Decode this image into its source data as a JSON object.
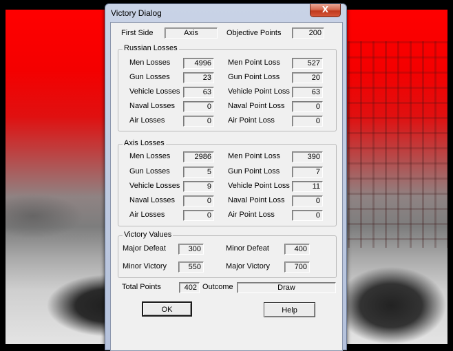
{
  "window": {
    "title": "Victory Dialog",
    "close_glyph": "X"
  },
  "first_side": {
    "label": "First Side",
    "value": "Axis"
  },
  "objective_points": {
    "label": "Objective Points",
    "value": "200"
  },
  "russian_losses": {
    "title": "Russian Losses",
    "rows": [
      {
        "left_label": "Men Losses",
        "left_value": "4996",
        "right_label": "Men Point Loss",
        "right_value": "527"
      },
      {
        "left_label": "Gun Losses",
        "left_value": "23",
        "right_label": "Gun Point Loss",
        "right_value": "20"
      },
      {
        "left_label": "Vehicle Losses",
        "left_value": "63",
        "right_label": "Vehicle Point Loss",
        "right_value": "63"
      },
      {
        "left_label": "Naval Losses",
        "left_value": "0",
        "right_label": "Naval Point Loss",
        "right_value": "0"
      },
      {
        "left_label": "Air Losses",
        "left_value": "0",
        "right_label": "Air Point Loss",
        "right_value": "0"
      }
    ]
  },
  "axis_losses": {
    "title": "Axis Losses",
    "rows": [
      {
        "left_label": "Men Losses",
        "left_value": "2986",
        "right_label": "Men Point Loss",
        "right_value": "390"
      },
      {
        "left_label": "Gun Losses",
        "left_value": "5",
        "right_label": "Gun Point Loss",
        "right_value": "7"
      },
      {
        "left_label": "Vehicle Losses",
        "left_value": "9",
        "right_label": "Vehicle Point Loss",
        "right_value": "11"
      },
      {
        "left_label": "Naval Losses",
        "left_value": "0",
        "right_label": "Naval Point Loss",
        "right_value": "0"
      },
      {
        "left_label": "Air Losses",
        "left_value": "0",
        "right_label": "Air Point Loss",
        "right_value": "0"
      }
    ]
  },
  "victory_values": {
    "title": "Victory Values",
    "major_defeat": {
      "label": "Major Defeat",
      "value": "300"
    },
    "minor_defeat": {
      "label": "Minor Defeat",
      "value": "400"
    },
    "minor_victory": {
      "label": "Minor Victory",
      "value": "550"
    },
    "major_victory": {
      "label": "Major Victory",
      "value": "700"
    }
  },
  "total_points": {
    "label": "Total Points",
    "value": "402"
  },
  "outcome": {
    "label": "Outcome",
    "value": "Draw"
  },
  "buttons": {
    "ok": "OK",
    "help": "Help"
  }
}
